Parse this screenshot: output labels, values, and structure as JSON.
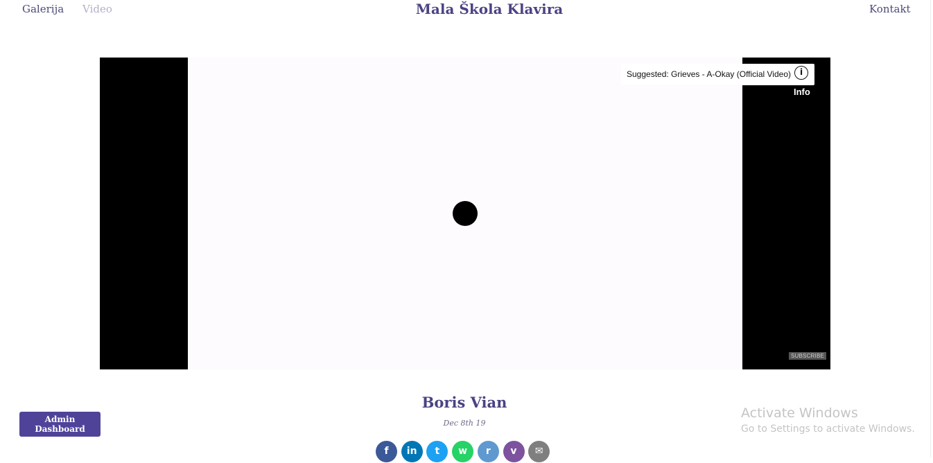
{
  "nav": {
    "gallery": "Galerija",
    "video": "Video",
    "contact": "Kontakt"
  },
  "site_title": "Mala Škola Klavira",
  "video": {
    "suggested": "Suggested: Grieves - A-Okay (Official Video)",
    "info_icon": "i",
    "info_label": "Info",
    "subscribe": "SUBSCRIBE"
  },
  "post": {
    "title": "Boris Vian",
    "date": "Dec 8th 19"
  },
  "admin_button": "Admin Dashboard",
  "share": [
    {
      "name": "facebook-icon",
      "glyph": "f",
      "color": "#3b5998"
    },
    {
      "name": "linkedin-icon",
      "glyph": "in",
      "color": "#0077b5"
    },
    {
      "name": "twitter-icon",
      "glyph": "t",
      "color": "#1da1f2"
    },
    {
      "name": "whatsapp-icon",
      "glyph": "w",
      "color": "#25d366"
    },
    {
      "name": "reddit-icon",
      "glyph": "r",
      "color": "#5f99cf"
    },
    {
      "name": "viber-icon",
      "glyph": "v",
      "color": "#7d529e"
    },
    {
      "name": "email-icon",
      "glyph": "✉",
      "color": "#7f7f7f"
    }
  ],
  "watermark": {
    "title": "Activate Windows",
    "subtitle": "Go to Settings to activate Windows."
  }
}
